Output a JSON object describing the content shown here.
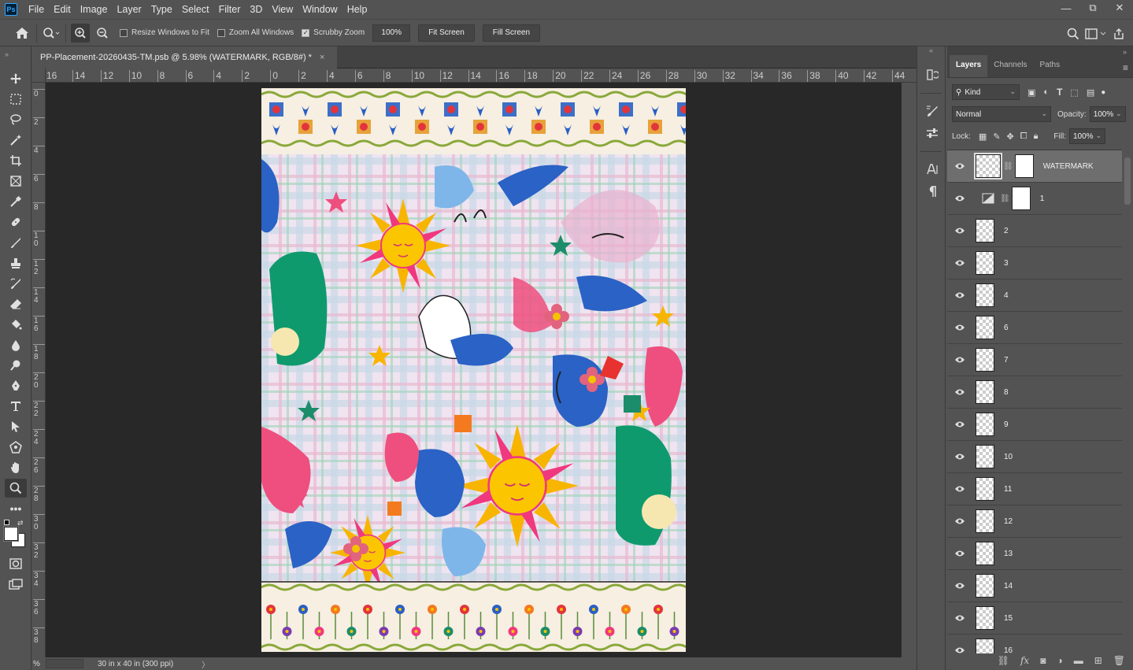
{
  "app": {
    "logo": "Ps"
  },
  "menu": [
    "File",
    "Edit",
    "Image",
    "Layer",
    "Type",
    "Select",
    "Filter",
    "3D",
    "View",
    "Window",
    "Help"
  ],
  "window_controls": {
    "minimize": "—",
    "restore": "⧉",
    "close": "✕"
  },
  "options": {
    "resize_windows": "Resize Windows to Fit",
    "resize_checked": false,
    "zoom_all": "Zoom All Windows",
    "zoom_all_checked": false,
    "scrubby": "Scrubby Zoom",
    "scrubby_checked": true,
    "zoom_value": "100%",
    "fit_screen": "Fit Screen",
    "fill_screen": "Fill Screen"
  },
  "document": {
    "tab_title": "PP-Placement-20260435-TM.psb @ 5.98% (WATERMARK, RGB/8#) *",
    "close": "×",
    "status_zoom": "%",
    "status_info": "30 in x 40 in (300 ppi)",
    "status_arrow": "〉"
  },
  "ruler": {
    "h_labels": [
      "16",
      "14",
      "12",
      "10",
      "8",
      "6",
      "4",
      "2",
      "0",
      "2",
      "4",
      "6",
      "8",
      "10",
      "12",
      "14",
      "16",
      "18",
      "20",
      "22",
      "24",
      "26",
      "28",
      "30",
      "32",
      "34",
      "36",
      "38",
      "40",
      "42",
      "44"
    ],
    "v_labels": [
      "0",
      "2",
      "4",
      "6",
      "8",
      "10",
      "12",
      "14",
      "16",
      "18",
      "20",
      "22",
      "24",
      "26",
      "28",
      "30",
      "32",
      "34",
      "36",
      "38"
    ]
  },
  "layers_panel": {
    "tabs": [
      "Layers",
      "Channels",
      "Paths"
    ],
    "filter_kind": "Kind",
    "blend_mode": "Normal",
    "opacity_label": "Opacity:",
    "opacity": "100%",
    "lock_label": "Lock:",
    "fill_label": "Fill:",
    "fill": "100%",
    "layers": [
      {
        "name": "WATERMARK",
        "selected": true,
        "mask": true
      },
      {
        "name": "1",
        "selected": false,
        "mask": true
      },
      {
        "name": "2"
      },
      {
        "name": "3"
      },
      {
        "name": "4"
      },
      {
        "name": "6"
      },
      {
        "name": "7"
      },
      {
        "name": "8"
      },
      {
        "name": "9"
      },
      {
        "name": "10"
      },
      {
        "name": "11"
      },
      {
        "name": "12"
      },
      {
        "name": "13"
      },
      {
        "name": "14"
      },
      {
        "name": "15"
      },
      {
        "name": "16"
      }
    ]
  },
  "colors": {
    "accent": "#31a8ff",
    "background": "#535353",
    "canvas": "#282828"
  }
}
